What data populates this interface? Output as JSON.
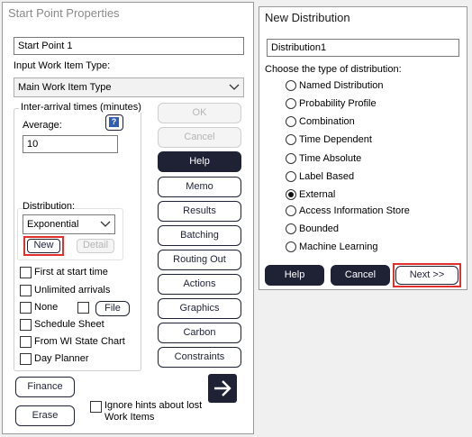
{
  "start_point": {
    "title": "Start Point Properties",
    "name_value": "Start Point 1",
    "input_type_label": "Input Work Item Type:",
    "input_type_value": "Main Work Item Type",
    "inter_arrival_label": "Inter-arrival times (minutes)",
    "average_label": "Average:",
    "help_glyph": "?",
    "average_value": "10",
    "distribution_label": "Distribution:",
    "distribution_value": "Exponential",
    "new_label": "New",
    "detail_label": "Detail",
    "options": [
      "First at start time",
      "Unlimited arrivals",
      "None",
      "File",
      "Schedule Sheet",
      "From WI State Chart",
      "Day Planner"
    ],
    "buttons": {
      "ok": "OK",
      "cancel": "Cancel",
      "help": "Help",
      "memo": "Memo",
      "results": "Results",
      "batching": "Batching",
      "routing_out": "Routing Out",
      "actions": "Actions",
      "graphics": "Graphics",
      "carbon": "Carbon",
      "constraints": "Constraints",
      "finance": "Finance",
      "erase": "Erase"
    },
    "ignore_hints": "Ignore hints about lost Work Items"
  },
  "new_distribution": {
    "title": "New Distribution",
    "name_value": "Distribution1",
    "choose_label": "Choose the type of distribution:",
    "types": [
      {
        "label": "Named Distribution",
        "selected": false
      },
      {
        "label": "Probability Profile",
        "selected": false
      },
      {
        "label": "Combination",
        "selected": false
      },
      {
        "label": "Time Dependent",
        "selected": false
      },
      {
        "label": "Time Absolute",
        "selected": false
      },
      {
        "label": "Label Based",
        "selected": false
      },
      {
        "label": "External",
        "selected": true
      },
      {
        "label": "Access Information Store",
        "selected": false
      },
      {
        "label": "Bounded",
        "selected": false
      },
      {
        "label": "Machine Learning",
        "selected": false
      }
    ],
    "buttons": {
      "help": "Help",
      "cancel": "Cancel",
      "next": "Next >>"
    }
  },
  "colors": {
    "dark_button": "#1f2235",
    "highlight": "#e0312c",
    "help_icon": "#2f5fb3"
  }
}
